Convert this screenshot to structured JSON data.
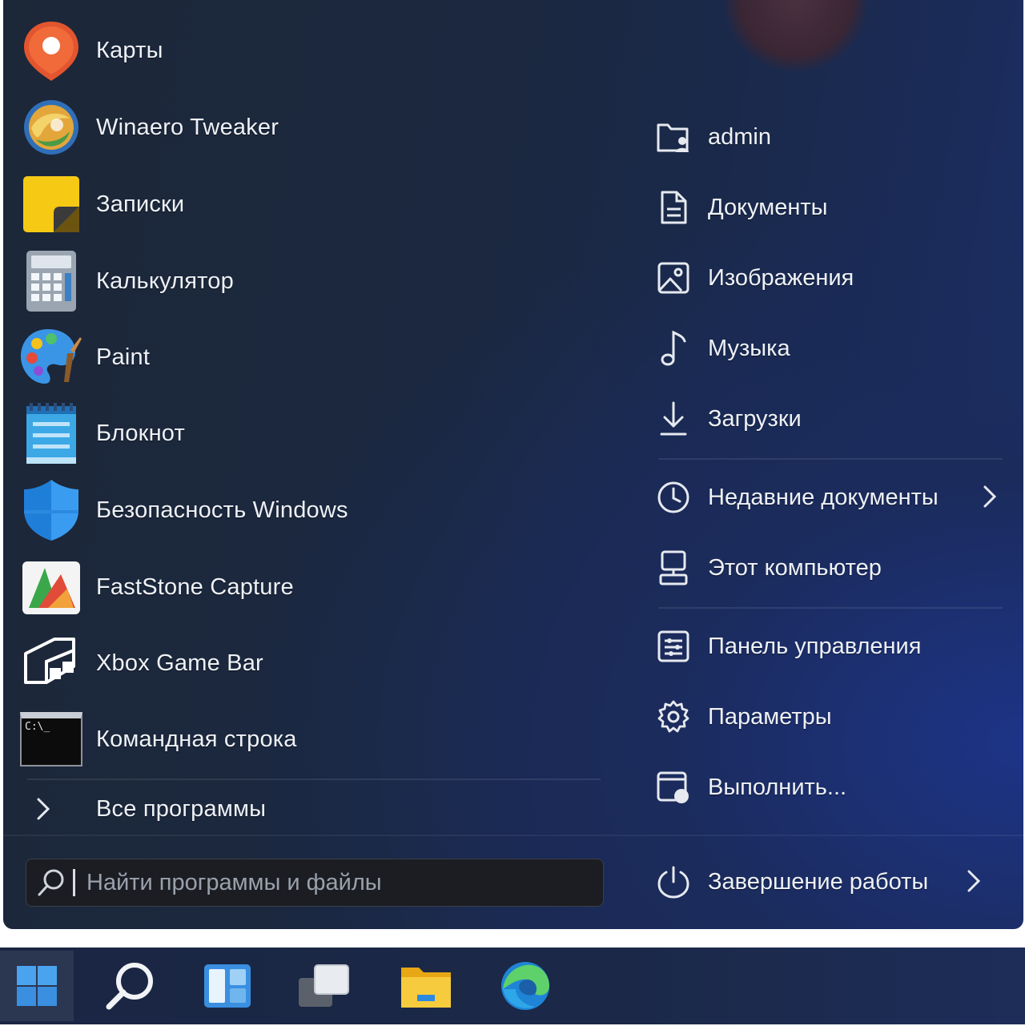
{
  "apps": [
    {
      "label": "Карты",
      "icon": "maps-icon"
    },
    {
      "label": "Winaero Tweaker",
      "icon": "winaero-tweaker-icon"
    },
    {
      "label": "Записки",
      "icon": "sticky-notes-icon"
    },
    {
      "label": "Калькулятор",
      "icon": "calculator-icon"
    },
    {
      "label": "Paint",
      "icon": "paint-icon"
    },
    {
      "label": "Блокнот",
      "icon": "notepad-icon"
    },
    {
      "label": "Безопасность Windows",
      "icon": "windows-security-icon"
    },
    {
      "label": "FastStone Capture",
      "icon": "faststone-capture-icon"
    },
    {
      "label": "Xbox Game Bar",
      "icon": "xbox-game-bar-icon"
    },
    {
      "label": "Командная строка",
      "icon": "command-prompt-icon"
    }
  ],
  "all_programs": {
    "label": "Все программы",
    "icon": "chevron-right-icon"
  },
  "search": {
    "placeholder": "Найти программы и файлы",
    "icon": "search-icon"
  },
  "cmd_icon_text": "C:\\_",
  "places": [
    {
      "label": "admin",
      "icon": "user-folder-icon"
    },
    {
      "label": "Документы",
      "icon": "document-icon"
    },
    {
      "label": "Изображения",
      "icon": "picture-icon"
    },
    {
      "label": "Музыка",
      "icon": "music-note-icon"
    },
    {
      "label": "Загрузки",
      "icon": "download-icon"
    }
  ],
  "recent": {
    "label": "Недавние документы",
    "icon": "clock-icon",
    "has_submenu": true
  },
  "computer": {
    "label": "Этот компьютер",
    "icon": "computer-icon"
  },
  "system": [
    {
      "label": "Панель управления",
      "icon": "control-panel-icon"
    },
    {
      "label": "Параметры",
      "icon": "gear-icon"
    },
    {
      "label": "Выполнить...",
      "icon": "run-icon"
    }
  ],
  "shutdown": {
    "label": "Завершение работы",
    "icon": "power-icon",
    "has_submenu": true
  },
  "taskbar": [
    {
      "name": "start-button",
      "icon": "windows-logo-icon",
      "active": true
    },
    {
      "name": "search-button",
      "icon": "search-icon"
    },
    {
      "name": "widgets-button",
      "icon": "widgets-icon"
    },
    {
      "name": "task-view-button",
      "icon": "task-view-icon"
    },
    {
      "name": "file-explorer-button",
      "icon": "folder-icon"
    },
    {
      "name": "edge-button",
      "icon": "edge-icon"
    }
  ],
  "colors": {
    "menu_bg": "#1b2840",
    "text": "#eef1f6",
    "accent": "#3a8fe0"
  }
}
